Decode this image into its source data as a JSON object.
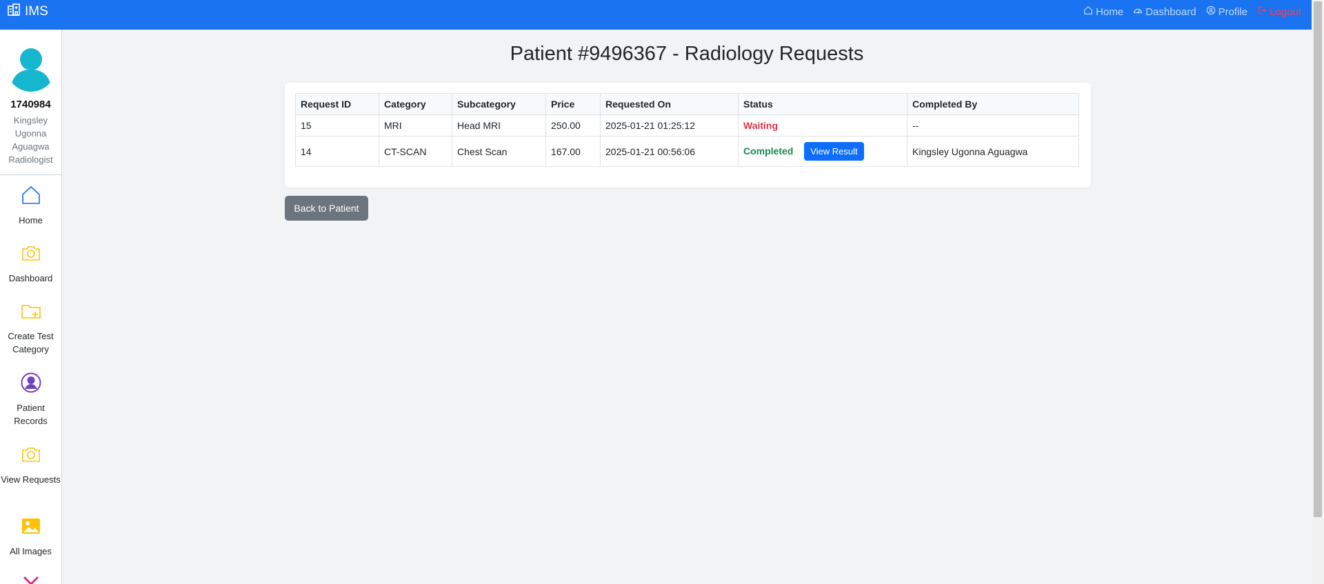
{
  "app": {
    "brand": "IMS",
    "brand_icon": "hospital-icon"
  },
  "nav": {
    "links": [
      {
        "label": "Home",
        "icon": "house-icon"
      },
      {
        "label": "Dashboard",
        "icon": "speedometer-icon"
      },
      {
        "label": "Profile",
        "icon": "person-circle-icon"
      },
      {
        "label": "Logout",
        "icon": "logout-icon",
        "color": "#ff3b4e"
      }
    ]
  },
  "user": {
    "id": "1740984",
    "name": "Kingsley Ugonna Aguagwa",
    "role": "Radiologist"
  },
  "sidebar": {
    "items": [
      {
        "label": "Home",
        "icon": "house-icon",
        "color": "#0d6efd"
      },
      {
        "label": "Dashboard",
        "icon": "camera-icon",
        "color": "#ffc107"
      },
      {
        "label": "Create Test Category",
        "icon": "folder-plus-icon",
        "color": "#ffc107"
      },
      {
        "label": "Patient Records",
        "icon": "person-circle-icon",
        "color": "#6f42c1"
      },
      {
        "label": "View Requests",
        "icon": "camera-icon",
        "color": "#ffc107"
      },
      {
        "label": "All Images",
        "icon": "image-icon",
        "color": "#ffc107"
      },
      {
        "label": "",
        "icon": "tools-icon",
        "color": "#d63384"
      }
    ]
  },
  "page": {
    "title": "Patient #9496367 - Radiology Requests",
    "back_button": "Back to Patient"
  },
  "table": {
    "headers": [
      "Request ID",
      "Category",
      "Subcategory",
      "Price",
      "Requested On",
      "Status",
      "Completed By"
    ],
    "rows": [
      {
        "id": "15",
        "category": "MRI",
        "subcategory": "Head MRI",
        "price": "250.00",
        "requested_on": "2025-01-21 01:25:12",
        "status": "Waiting",
        "completed_by": "--"
      },
      {
        "id": "14",
        "category": "CT-SCAN",
        "subcategory": "Chest Scan",
        "price": "167.00",
        "requested_on": "2025-01-21 00:56:06",
        "status": "Completed",
        "action": "View Result",
        "completed_by": "Kingsley Ugonna Aguagwa"
      }
    ]
  },
  "colors": {
    "navbar": "#1a73f0",
    "waiting": "#dc3545",
    "completed": "#198754",
    "primary_button": "#0d6efd",
    "secondary_button": "#6c757d"
  }
}
